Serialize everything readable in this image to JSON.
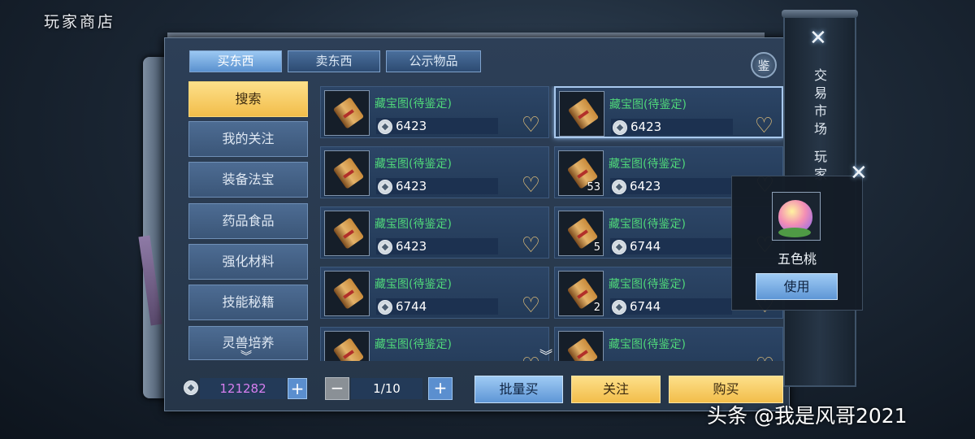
{
  "window": {
    "title": "玩家商店"
  },
  "tabs": [
    {
      "label": "买东西",
      "active": true
    },
    {
      "label": "卖东西",
      "active": false
    },
    {
      "label": "公示物品",
      "active": false
    }
  ],
  "appraise_button": {
    "label": "鉴"
  },
  "categories": [
    {
      "label": "搜索",
      "active": true
    },
    {
      "label": "我的关注"
    },
    {
      "label": "装备法宝"
    },
    {
      "label": "药品食品"
    },
    {
      "label": "强化材料"
    },
    {
      "label": "技能秘籍"
    },
    {
      "label": "灵兽培养"
    }
  ],
  "listings": [
    {
      "name": "藏宝图(待鉴定)",
      "price": "6423",
      "quantity": "",
      "selected": false
    },
    {
      "name": "藏宝图(待鉴定)",
      "price": "6423",
      "quantity": "",
      "selected": true
    },
    {
      "name": "藏宝图(待鉴定)",
      "price": "6423",
      "quantity": "",
      "selected": false
    },
    {
      "name": "藏宝图(待鉴定)",
      "price": "6423",
      "quantity": "53",
      "selected": false
    },
    {
      "name": "藏宝图(待鉴定)",
      "price": "6423",
      "quantity": "",
      "selected": false
    },
    {
      "name": "藏宝图(待鉴定)",
      "price": "6744",
      "quantity": "5",
      "selected": false
    },
    {
      "name": "藏宝图(待鉴定)",
      "price": "6744",
      "quantity": "",
      "selected": false
    },
    {
      "name": "藏宝图(待鉴定)",
      "price": "6744",
      "quantity": "2",
      "selected": false
    },
    {
      "name": "藏宝图(待鉴定)",
      "price": "",
      "quantity": "",
      "selected": false
    },
    {
      "name": "藏宝图(待鉴定)",
      "price": "",
      "quantity": "",
      "selected": false
    }
  ],
  "footer": {
    "balance": "121282",
    "topup_label": "+",
    "minus_label": "−",
    "page": "1/10",
    "plus_label": "+",
    "bulk_buy_label": "批量买",
    "follow_label": "关注",
    "buy_label": "购买"
  },
  "side_panel": {
    "market_label": "交易市场",
    "player_label": "玩家"
  },
  "popup": {
    "item_name": "五色桃",
    "use_label": "使用"
  },
  "watermark": "头条 @我是风哥2021",
  "icons": {
    "close": "close-icon",
    "currency": "coin-icon",
    "favorite": "heart-icon",
    "more": "chevron-down-icon"
  }
}
